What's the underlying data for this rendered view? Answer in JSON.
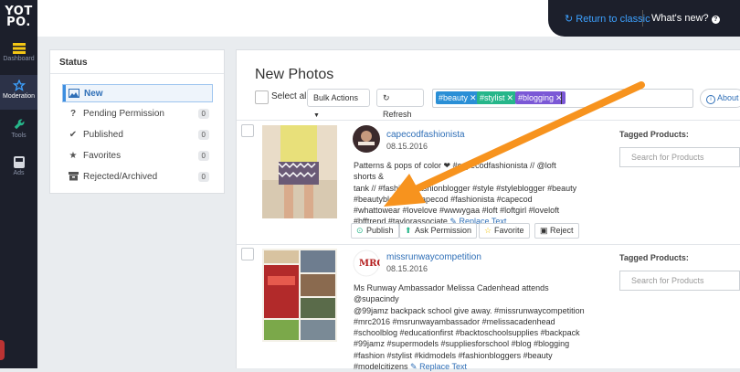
{
  "app": {
    "logo_line1": "YOT",
    "logo_line2": "PO.",
    "return_link": "Return to classic",
    "whats_new": "What's new?"
  },
  "sidebar": {
    "items": [
      {
        "label": "Dashboard",
        "icon": "dashboard-icon"
      },
      {
        "label": "Moderation",
        "icon": "star-icon",
        "active": true
      },
      {
        "label": "Tools",
        "icon": "wrench-icon"
      },
      {
        "label": "Ads",
        "icon": "ads-icon"
      }
    ]
  },
  "status": {
    "title": "Status",
    "items": [
      {
        "label": "New",
        "icon": "image-icon",
        "active": true
      },
      {
        "label": "Pending Permission",
        "count": "0",
        "icon": "question-icon"
      },
      {
        "label": "Published",
        "count": "0",
        "icon": "check-icon"
      },
      {
        "label": "Favorites",
        "count": "0",
        "icon": "star-icon"
      },
      {
        "label": "Rejected/Archived",
        "count": "0",
        "icon": "archive-icon"
      }
    ]
  },
  "main": {
    "title": "New Photos",
    "select_all": "Select all",
    "bulk_actions": "Bulk Actions",
    "refresh": "Refresh",
    "tags": [
      {
        "label": "#beauty",
        "color": "#2a8fd6"
      },
      {
        "label": "#stylist",
        "color": "#26b68a"
      },
      {
        "label": "#blogging",
        "color": "#7b58d6"
      }
    ],
    "about": "About"
  },
  "posts": [
    {
      "username": "capecodfashionista",
      "date": "08.15.2016",
      "caption_lines": [
        "Patterns & pops of color ❤ #capecodfashionista // @loft shorts &",
        "tank // #fashion #fashionblogger #style #styleblogger #beauty",
        "#beautyblogger #capecod #fashionista #capecod",
        "#whattowear #lovelove #wwwygaa #loft #loftgirl #loveloft",
        "#bfftrend #taylorassociate"
      ],
      "replace_text": "Replace Text",
      "tagged_label": "Tagged Products:",
      "search_placeholder": "Search for Products",
      "actions": {
        "publish": "Publish",
        "ask": "Ask Permission",
        "favorite": "Favorite",
        "reject": "Reject"
      }
    },
    {
      "username": "missrunwaycompetition",
      "date": "08.15.2016",
      "caption_lines": [
        "Ms Runway Ambassador Melissa Cadenhead attends @supacindy",
        "@99jamz backpack school give away. #missrunwaycompetition",
        "#mrc2016 #msrunwayambassador #melissacadenhead",
        "#schoolblog #educationfirst #backtoschoolsupplies #backpack",
        "#99jamz #supermodels #suppliesforschool #blog #blogging",
        "#fashion #stylist #kidmodels #fashionbloggers #beauty",
        "#modelcitizens"
      ],
      "replace_text": "Replace Text",
      "tagged_label": "Tagged Products:",
      "search_placeholder": "Search for Products"
    }
  ],
  "colors": {
    "accent": "#2f6fb7",
    "dark": "#1c1f2b",
    "arrow": "#f7931e"
  }
}
